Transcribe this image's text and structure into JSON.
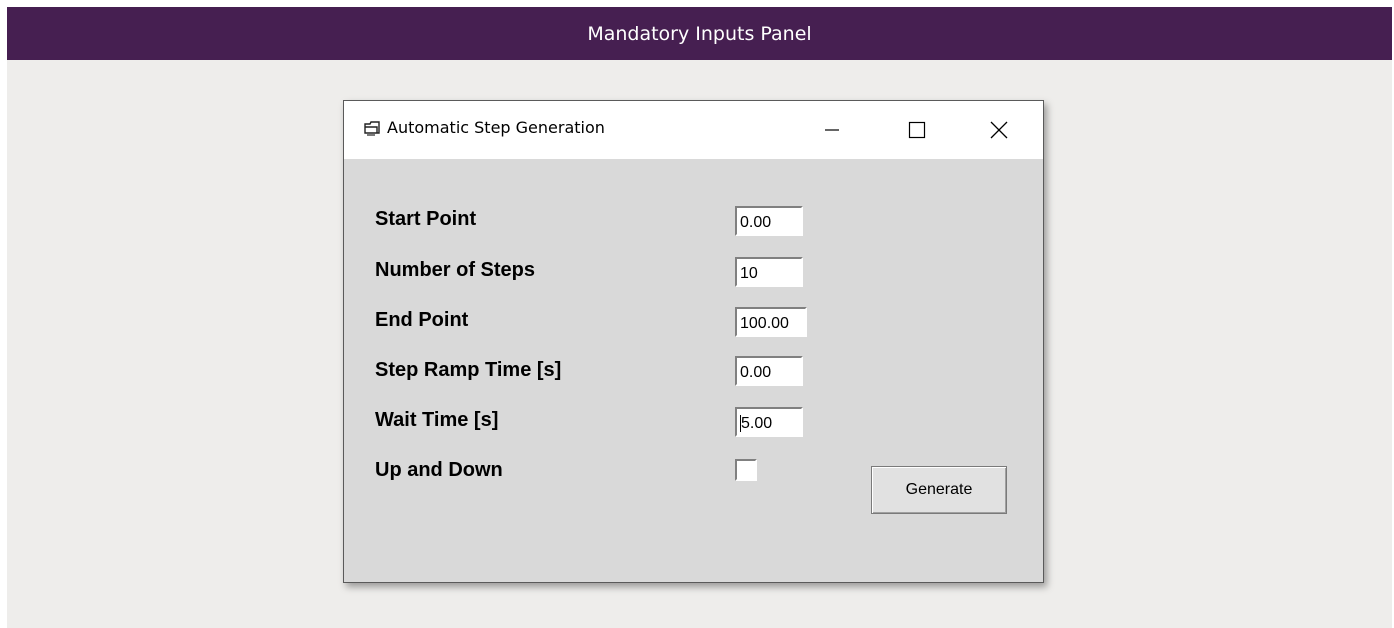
{
  "header": {
    "title": "Mandatory Inputs Panel"
  },
  "dialog": {
    "title": "Automatic Step Generation",
    "icons": {
      "app": "window-icon",
      "minimize": "minimize-icon",
      "maximize": "maximize-icon",
      "close": "close-icon"
    },
    "fields": [
      {
        "label": "Start Point",
        "value": "0.00"
      },
      {
        "label": "Number of Steps",
        "value": "10"
      },
      {
        "label": "End Point",
        "value": "100.00"
      },
      {
        "label": "Step Ramp Time [s]",
        "value": "0.00"
      },
      {
        "label": "Wait Time [s]",
        "value": "5.00"
      }
    ],
    "up_and_down": {
      "label": "Up and Down",
      "checked": false
    },
    "generate_label": "Generate"
  },
  "colors": {
    "header_bg": "#461f51",
    "page_bg": "#eeedeb",
    "dialog_bg": "#d9d9d9"
  }
}
